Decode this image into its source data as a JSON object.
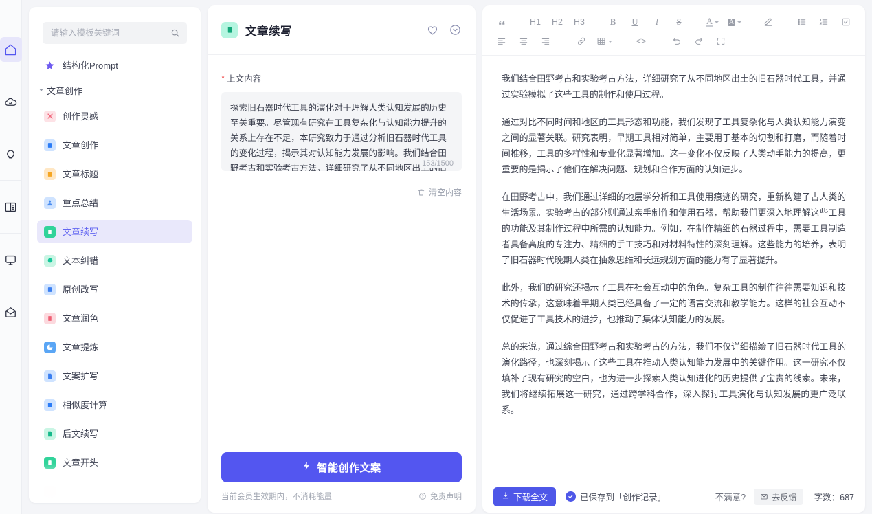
{
  "rail": {
    "items": [
      {
        "name": "home-icon",
        "active": true
      },
      {
        "name": "cloud-check-icon",
        "active": false
      },
      {
        "name": "lightbulb-icon",
        "active": false
      },
      {
        "name": "book-open-icon",
        "active": false
      },
      {
        "name": "monitor-icon",
        "active": false
      },
      {
        "name": "mail-open-icon",
        "active": false
      }
    ]
  },
  "sidebar": {
    "search": {
      "value": "",
      "placeholder": "请输入模板关键词"
    },
    "pinned": {
      "label": "结构化Prompt",
      "icon_color": "#6f5bf0"
    },
    "group": {
      "label": "文章创作",
      "expanded": true
    },
    "items": [
      {
        "label": "创作灵感",
        "bg": "#fde2e6",
        "fg": "#f06a7e",
        "glyph": "✕"
      },
      {
        "label": "文章创作",
        "bg": "#cfe3ff",
        "fg": "#2b7cf6",
        "glyph": "▤"
      },
      {
        "label": "文章标题",
        "bg": "#ffe7c4",
        "fg": "#f5a623",
        "glyph": "▤"
      },
      {
        "label": "重点总结",
        "bg": "#cfe3ff",
        "fg": "#4a8df0",
        "glyph": "▥"
      },
      {
        "label": "文章续写",
        "bg": "#31d39a",
        "fg": "#ffffff",
        "glyph": "▌",
        "active": true
      },
      {
        "label": "文本纠错",
        "bg": "#c9f5e4",
        "fg": "#16c79a",
        "glyph": "●"
      },
      {
        "label": "原创改写",
        "bg": "#cfe3ff",
        "fg": "#3b7ff0",
        "glyph": "▤"
      },
      {
        "label": "文章润色",
        "bg": "#fcd9de",
        "fg": "#ef5f73",
        "glyph": "▐"
      },
      {
        "label": "文章提炼",
        "bg": "#5aa6f5",
        "fg": "#ffffff",
        "glyph": "◔"
      },
      {
        "label": "文案扩写",
        "bg": "#cfe3ff",
        "fg": "#3b7ff0",
        "glyph": "▨"
      },
      {
        "label": "相似度计算",
        "bg": "#cfe3ff",
        "fg": "#2b7cf6",
        "glyph": "▤"
      },
      {
        "label": "后文续写",
        "bg": "#c9f5e4",
        "fg": "#16b98a",
        "glyph": "▨"
      },
      {
        "label": "文章开头",
        "bg": "#31d39a",
        "fg": "#ffffff",
        "glyph": "▌"
      },
      {
        "label": "",
        "bg": "#fcd9de",
        "fg": "#ef5f73",
        "glyph": ""
      }
    ]
  },
  "middle": {
    "title": "文章续写",
    "heart_icon": "heart-icon",
    "collapse_icon": "chevron-circle-icon",
    "field": {
      "label": "上文内容",
      "required_mark": "*",
      "value": "探索旧石器时代工具的演化对于理解人类认知发展的历史至关重要。尽管现有研究在工具复杂化与认知能力提升的关系上存在不足，本研究致力于通过分析旧石器时代工具的变化过程，揭示其对认知能力发展的影响。我们结合田野考古和实验考古方法，详细研究了从不同地区出土的旧石器时代工具，并通过实验模拟了这些工具的制作和使用过程。",
      "placeholder": "",
      "counter": "153/1500"
    },
    "clear_label": "清空内容",
    "generate_label": "智能创作文案",
    "generate_icon": "lightning-icon",
    "footer_note": "当前会员生效期内，不消耗能量",
    "disclaimer_label": "免责声明",
    "disclaimer_icon": "question-circle-icon"
  },
  "editor": {
    "toolbar_row1": [
      {
        "label": "❝",
        "name": "blockquote-icon",
        "caret": false
      },
      {
        "label": "H1",
        "name": "heading-1-button",
        "caret": false
      },
      {
        "label": "H2",
        "name": "heading-2-button",
        "caret": false
      },
      {
        "label": "H3",
        "name": "heading-3-button",
        "caret": false
      },
      {
        "label": "B",
        "name": "bold-button",
        "caret": false
      },
      {
        "label": "U",
        "name": "underline-button",
        "caret": false
      },
      {
        "label": "I",
        "name": "italic-button",
        "caret": false
      },
      {
        "label": "S",
        "name": "strikethrough-button",
        "caret": false
      },
      {
        "label": "A",
        "name": "text-color-button",
        "caret": true
      },
      {
        "label": "A",
        "name": "highlight-color-button",
        "caret": true
      },
      {
        "label": "",
        "name": "clear-format-icon",
        "caret": false
      },
      {
        "label": "",
        "name": "bullet-list-icon",
        "caret": false
      },
      {
        "label": "",
        "name": "ordered-list-icon",
        "caret": false
      },
      {
        "label": "",
        "name": "checklist-icon",
        "caret": false
      }
    ],
    "toolbar_row2": [
      {
        "label": "",
        "name": "align-left-icon",
        "caret": false
      },
      {
        "label": "",
        "name": "align-center-icon",
        "caret": false
      },
      {
        "label": "",
        "name": "align-right-icon",
        "caret": false
      },
      {
        "label": "",
        "name": "link-icon",
        "caret": false
      },
      {
        "label": "",
        "name": "table-icon",
        "caret": true
      },
      {
        "label": "<>",
        "name": "code-block-button",
        "caret": false
      },
      {
        "label": "",
        "name": "undo-icon",
        "caret": false
      },
      {
        "label": "",
        "name": "redo-icon",
        "caret": false
      },
      {
        "label": "",
        "name": "fullscreen-icon",
        "caret": false
      }
    ],
    "paragraphs": [
      "我们结合田野考古和实验考古方法，详细研究了从不同地区出土的旧石器时代工具，并通过实验模拟了这些工具的制作和使用过程。",
      "通过对比不同时间和地区的工具形态和功能，我们发现了工具复杂化与人类认知能力演变之间的显著关联。研究表明，早期工具相对简单，主要用于基本的切割和打磨，而随着时间推移，工具的多样性和专业化显著增加。这一变化不仅反映了人类动手能力的提高，更重要的是揭示了他们在解决问题、规划和合作方面的认知进步。",
      "在田野考古中，我们通过详细的地层学分析和工具使用痕迹的研究，重新构建了古人类的生活场景。实验考古的部分则通过亲手制作和使用石器，帮助我们更深入地理解这些工具的功能及其制作过程中所需的认知能力。例如，在制作精细的石器过程中，需要工具制造者具备高度的专注力、精细的手工技巧和对材料特性的深刻理解。这些能力的培养，表明了旧石器时代晚期人类在抽象思维和长远规划方面的能力有了显著提升。",
      "此外，我们的研究还揭示了工具在社会互动中的角色。复杂工具的制作往往需要知识和技术的传承，这意味着早期人类已经具备了一定的语言交流和教学能力。这样的社会互动不仅促进了工具技术的进步，也推动了集体认知能力的发展。",
      "总的来说，通过综合田野考古和实验考古的方法，我们不仅详细描绘了旧石器时代工具的演化路径，也深刻揭示了这些工具在推动人类认知能力发展中的关键作用。这一研究不仅填补了现有研究的空白，也为进一步探索人类认知进化的历史提供了宝贵的线索。未来，我们将继续拓展这一研究，通过跨学科合作，深入探讨工具演化与认知发展的更广泛联系。"
    ],
    "footer": {
      "download_label": "下载全文",
      "download_icon": "download-icon",
      "saved_text": "已保存到「创作记录」",
      "saved_icon": "check-circle-icon",
      "unhappy_label": "不满意?",
      "feedback_label": "去反馈",
      "feedback_icon": "feedback-icon",
      "word_count_label": "字数：",
      "word_count_value": "687"
    }
  },
  "colors": {
    "primary": "#5356f0",
    "download_button": "#4e57e8",
    "active_item_bg": "#e9e8fb",
    "page_bg": "#f4f5f8"
  }
}
